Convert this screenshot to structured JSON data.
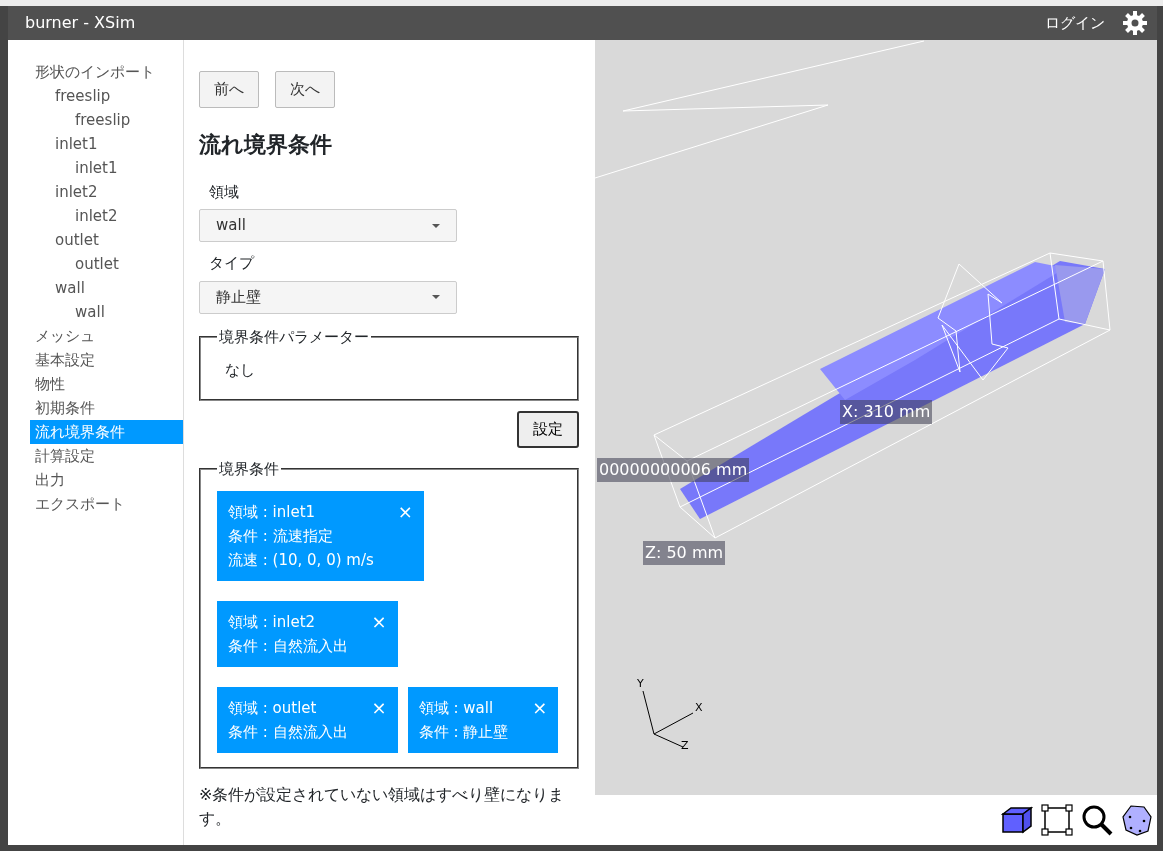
{
  "window": {
    "title": "burner - XSim"
  },
  "header": {
    "login": "ログイン"
  },
  "sidebar": {
    "items": [
      {
        "label": "形状のインポート",
        "selected": false,
        "children": [
          {
            "label": "freeslip",
            "selected": false,
            "children": [
              {
                "label": "freeslip",
                "selected": false
              }
            ]
          },
          {
            "label": "inlet1",
            "selected": false,
            "children": [
              {
                "label": "inlet1",
                "selected": false
              }
            ]
          },
          {
            "label": "inlet2",
            "selected": false,
            "children": [
              {
                "label": "inlet2",
                "selected": false
              }
            ]
          },
          {
            "label": "outlet",
            "selected": false,
            "children": [
              {
                "label": "outlet",
                "selected": false
              }
            ]
          },
          {
            "label": "wall",
            "selected": false,
            "children": [
              {
                "label": "wall",
                "selected": false
              }
            ]
          }
        ]
      },
      {
        "label": "メッシュ",
        "selected": false
      },
      {
        "label": "基本設定",
        "selected": false
      },
      {
        "label": "物性",
        "selected": false
      },
      {
        "label": "初期条件",
        "selected": false
      },
      {
        "label": "流れ境界条件",
        "selected": true
      },
      {
        "label": "計算設定",
        "selected": false
      },
      {
        "label": "出力",
        "selected": false
      },
      {
        "label": "エクスポート",
        "selected": false
      }
    ]
  },
  "nav_buttons": [
    "前へ",
    "次へ"
  ],
  "form": {
    "heading": "流れ境界条件",
    "fields": [
      {
        "label": "領域",
        "value": "wall"
      },
      {
        "label": "タイプ",
        "value": "静止壁"
      }
    ],
    "parameters": {
      "legend": "境界条件パラメーター",
      "text": "なし"
    },
    "set_button": "設定",
    "conditions": {
      "legend": "境界条件",
      "items": [
        {
          "lines": [
            "領域 : inlet1",
            "条件 : 流速指定",
            "流速 : (10, 0, 0) m/s"
          ],
          "close": "×"
        },
        {
          "lines": [
            "領域 : inlet2",
            "条件 : 自然流入出"
          ],
          "close": "×"
        },
        {
          "lines": [
            "領域 : outlet",
            "条件 : 自然流入出"
          ],
          "close": "×"
        },
        {
          "lines": [
            "領域 : wall",
            "条件 : 静止壁"
          ],
          "close": "×"
        }
      ]
    },
    "note": "※条件が設定されていない領域はすべり壁になります。"
  },
  "viewport": {
    "dimension_labels": [
      "X: 310 mm",
      "00000000006 mm",
      "Z: 50 mm"
    ],
    "axis_labels": [
      "Y",
      "X",
      "Z"
    ]
  }
}
